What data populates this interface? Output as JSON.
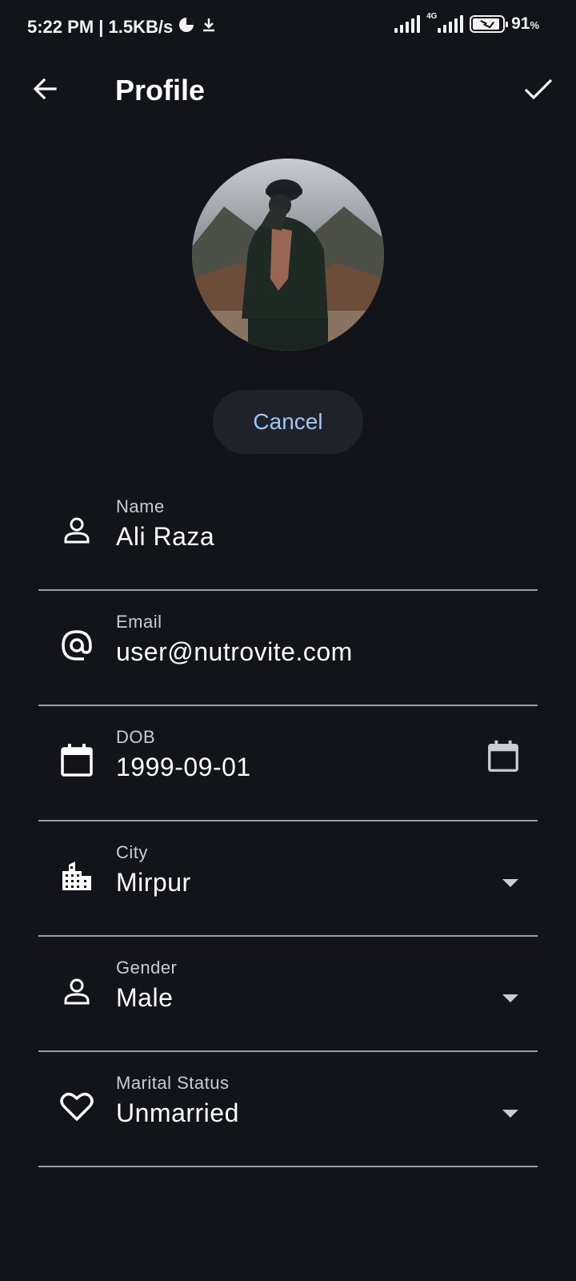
{
  "status_bar": {
    "time": "5:22 PM | 1.5KB/s",
    "network_type": "4G",
    "battery": "91",
    "battery_unit": "%",
    "battery_level": 0.91
  },
  "app_bar": {
    "title": "Profile",
    "back_icon": "arrow-back-icon",
    "save_icon": "check-icon"
  },
  "avatar": {
    "icon": "profile-photo"
  },
  "cancel_label": "Cancel",
  "fields": [
    {
      "label": "Name",
      "value": "Ali Raza",
      "icon": "person-icon"
    },
    {
      "label": "Email",
      "value": "user@nutrovite.com",
      "icon": "at-icon"
    },
    {
      "label": "DOB",
      "value": "1999-09-01",
      "icon": "calendar-icon",
      "trailing": "calendar-picker-icon"
    },
    {
      "label": "City",
      "value": "Mirpur",
      "icon": "city-icon",
      "trailing": "dropdown-arrow-icon"
    },
    {
      "label": "Gender",
      "value": "Male",
      "icon": "person-icon",
      "trailing": "dropdown-arrow-icon"
    },
    {
      "label": "Marital Status",
      "value": "Unmarried",
      "icon": "heart-icon",
      "trailing": "dropdown-arrow-icon"
    }
  ],
  "colors": {
    "background": "#121419",
    "accent": "#9ec6f6",
    "divider": "#9a9ea6"
  }
}
